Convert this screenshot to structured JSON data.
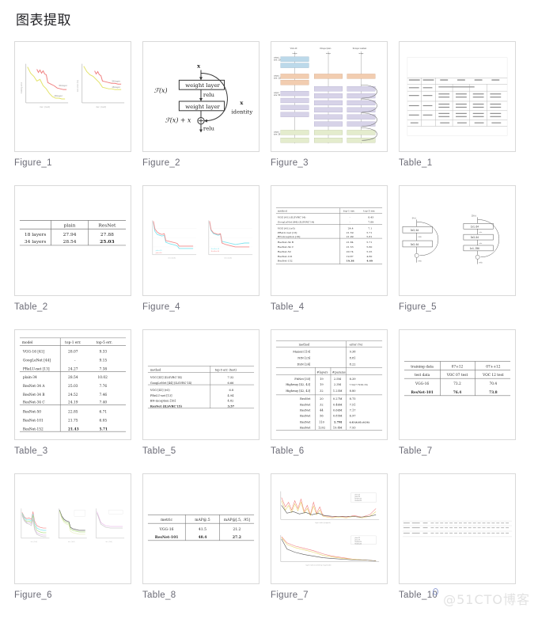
{
  "header": {
    "title": "图表提取"
  },
  "watermark": {
    "text": "@51CTO博客"
  },
  "grid": {
    "columns": 4,
    "items": [
      {
        "id": "figure-1",
        "caption": "Figure_1",
        "kind": "figure",
        "variant": "training-curves-2"
      },
      {
        "id": "figure-2",
        "caption": "Figure_2",
        "kind": "figure",
        "variant": "residual-block"
      },
      {
        "id": "figure-3",
        "caption": "Figure_3",
        "kind": "figure",
        "variant": "network-columns"
      },
      {
        "id": "table-1",
        "caption": "Table_1",
        "kind": "table",
        "variant": "wide-arch-table"
      },
      {
        "id": "table-2",
        "caption": "Table_2",
        "kind": "table",
        "variant": "table2"
      },
      {
        "id": "figure-4",
        "caption": "Figure_4",
        "kind": "figure",
        "variant": "cyan-red-curves-2"
      },
      {
        "id": "table-4",
        "caption": "Table_4",
        "kind": "table",
        "variant": "table4"
      },
      {
        "id": "figure-5",
        "caption": "Figure_5",
        "kind": "figure",
        "variant": "bottleneck-pair"
      },
      {
        "id": "table-3",
        "caption": "Table_3",
        "kind": "table",
        "variant": "table3"
      },
      {
        "id": "table-5",
        "caption": "Table_5",
        "kind": "table",
        "variant": "table5"
      },
      {
        "id": "table-6",
        "caption": "Table_6",
        "kind": "table",
        "variant": "table6"
      },
      {
        "id": "table-7",
        "caption": "Table_7",
        "kind": "table",
        "variant": "table7"
      },
      {
        "id": "figure-6",
        "caption": "Figure_6",
        "kind": "figure",
        "variant": "cifar-curves-3"
      },
      {
        "id": "table-8",
        "caption": "Table_8",
        "kind": "table",
        "variant": "table8"
      },
      {
        "id": "figure-7",
        "caption": "Figure_7",
        "kind": "figure",
        "variant": "response-std-2"
      },
      {
        "id": "table-10",
        "caption": "Table_10",
        "kind": "table",
        "variant": "wide-strip-table"
      }
    ]
  },
  "figures": {
    "figure_1": {
      "panels": [
        {
          "ylabel": "training error (%)",
          "xlabel": "iter. (1e4)",
          "series": [
            {
              "name": "34-layer",
              "color": "#f08080"
            },
            {
              "name": "18-layer",
              "color": "#e3e36a"
            }
          ]
        },
        {
          "ylabel": "test error (%)",
          "xlabel": "iter. (1e4)",
          "series": [
            {
              "name": "34-layer",
              "color": "#f08080"
            },
            {
              "name": "18-layer",
              "color": "#e3e36a"
            }
          ]
        }
      ]
    },
    "figure_2": {
      "nodes": [
        "x",
        "weight layer",
        "relu",
        "weight layer"
      ],
      "labels": {
        "fx": "F(x)",
        "sum": "F(x) + x",
        "identity": "identity",
        "identity_x": "x",
        "out_relu": "relu"
      }
    },
    "figure_3": {
      "column_titles": [
        "VGG-19",
        "34-layer plain",
        "34-layer residual"
      ],
      "output_sizes": [
        "output size: 224",
        "output size: 112",
        "output size: 56",
        "output size: 28"
      ],
      "colors": {
        "image": "#bcd9ea",
        "conv64": "#f2cdb0",
        "conv128": "#d7d3e8",
        "conv256": "#e4eccd"
      }
    },
    "figure_4": {
      "panels": [
        {
          "series": [
            {
              "name": "plain-18",
              "color": "#7fe4ef"
            },
            {
              "name": "plain-34",
              "color": "#f28c8c"
            }
          ]
        },
        {
          "series": [
            {
              "name": "ResNet-18",
              "color": "#7fe4ef"
            },
            {
              "name": "ResNet-34",
              "color": "#f28c8c"
            }
          ]
        }
      ],
      "xlabel": "iter. (1e4)",
      "ylabel": "error (%)"
    },
    "figure_5": {
      "left": {
        "blocks": [
          "3x3, 64",
          "3x3, 64"
        ],
        "relu": "relu"
      },
      "right": {
        "blocks": [
          "1x1, 64",
          "3x3, 64",
          "1x1, 256"
        ],
        "relu": "relu"
      }
    },
    "figure_6": {
      "panels": [
        {
          "legend": [
            "20-layer",
            "32-layer",
            "44-layer",
            "56-layer",
            "110-layer"
          ],
          "xlabel": "iter. (1e4)",
          "ylabel": "error (%)"
        },
        {
          "legend": [
            "ResNet-20",
            "ResNet-32",
            "ResNet-44",
            "ResNet-56",
            "ResNet-110"
          ],
          "xlabel": "iter. (1e4)",
          "ylabel": "error (%)"
        },
        {
          "legend": [
            "ResNet-110",
            "ResNet-1202"
          ],
          "xlabel": "iter. (1e4)",
          "ylabel": "error (%)"
        }
      ]
    },
    "figure_7": {
      "panels": [
        {
          "xlabel": "layer index (original)",
          "ylabel": "std",
          "legend": [
            "plain-20",
            "plain-56",
            "ResNet-20",
            "ResNet-56",
            "ResNet-110"
          ]
        },
        {
          "xlabel": "layer index (sorted by magnitude)",
          "ylabel": "std",
          "legend": [
            "plain-20",
            "plain-56",
            "ResNet-20",
            "ResNet-56",
            "ResNet-110"
          ]
        }
      ]
    }
  },
  "tables": {
    "table_1": {
      "headers": [
        "layer name",
        "output size",
        "18-layer",
        "34-layer",
        "50-layer",
        "101-layer",
        "152-layer"
      ],
      "row_count": 6
    },
    "table_2": {
      "headers": [
        "",
        "plain",
        "ResNet"
      ],
      "rows": [
        {
          "cells": [
            "18 layers",
            "27.94",
            "27.88"
          ],
          "bold": []
        },
        {
          "cells": [
            "34 layers",
            "28.54",
            "25.03"
          ],
          "bold": [
            2
          ]
        }
      ]
    },
    "table_3": {
      "headers": [
        "model",
        "top-1 err.",
        "top-5 err."
      ],
      "groups": [
        [
          {
            "cells": [
              "VGG-16 [41]",
              "28.07",
              "9.33"
            ]
          },
          {
            "cells": [
              "GoogLeNet [44]",
              "-",
              "9.15"
            ]
          },
          {
            "cells": [
              "PReLU-net [13]",
              "24.27",
              "7.38"
            ]
          }
        ],
        [
          {
            "cells": [
              "plain-34",
              "28.54",
              "10.02"
            ]
          },
          {
            "cells": [
              "ResNet-34 A",
              "25.03",
              "7.76"
            ]
          },
          {
            "cells": [
              "ResNet-34 B",
              "24.52",
              "7.46"
            ]
          },
          {
            "cells": [
              "ResNet-34 C",
              "24.19",
              "7.40"
            ]
          }
        ],
        [
          {
            "cells": [
              "ResNet-50",
              "22.85",
              "6.71"
            ]
          },
          {
            "cells": [
              "ResNet-101",
              "21.75",
              "6.05"
            ]
          },
          {
            "cells": [
              "ResNet-152",
              "21.43",
              "5.71"
            ],
            "bold": [
              1,
              2
            ]
          }
        ]
      ]
    },
    "table_4": {
      "headers": [
        "method",
        "top-1 err.",
        "top-5 err."
      ],
      "groups": [
        [
          {
            "cells": [
              "VGG [41] (ILSVRC'14)",
              "-",
              "8.43"
            ]
          },
          {
            "cells": [
              "GoogLeNet [44] (ILSVRC'14)",
              "-",
              "7.89"
            ]
          }
        ],
        [
          {
            "cells": [
              "VGG [41] (v5)",
              "24.4",
              "7.1"
            ]
          },
          {
            "cells": [
              "PReLU-net [13]",
              "21.59",
              "5.71"
            ]
          },
          {
            "cells": [
              "BN-inception [16]",
              "21.99",
              "5.81"
            ]
          }
        ],
        [
          {
            "cells": [
              "ResNet-34 B",
              "21.84",
              "5.71"
            ]
          },
          {
            "cells": [
              "ResNet-34 C",
              "21.53",
              "5.60"
            ]
          },
          {
            "cells": [
              "ResNet-50",
              "20.74",
              "5.25"
            ]
          },
          {
            "cells": [
              "ResNet-101",
              "19.87",
              "4.60"
            ]
          },
          {
            "cells": [
              "ResNet-152",
              "19.38",
              "4.49"
            ],
            "bold": [
              1,
              2
            ]
          }
        ]
      ]
    },
    "table_5": {
      "headers": [
        "method",
        "top-5 err. (test)"
      ],
      "groups": [
        [
          {
            "cells": [
              "VGG [41] (ILSVRC'14)",
              "7.32"
            ]
          },
          {
            "cells": [
              "GoogLeNet [44] (ILSVRC'14)",
              "6.66"
            ]
          }
        ],
        [
          {
            "cells": [
              "VGG [41] (v5)",
              "6.8"
            ]
          },
          {
            "cells": [
              "PReLU-net [13]",
              "4.94"
            ]
          },
          {
            "cells": [
              "BN-inception [16]",
              "4.82"
            ]
          },
          {
            "cells": [
              "ResNet (ILSVRC'15)",
              "3.57"
            ],
            "bold": [
              0,
              1
            ]
          }
        ]
      ]
    },
    "table_6": {
      "headers": [
        "method",
        "error (%)"
      ],
      "sub_headers": [
        "",
        "# layers",
        "# params",
        ""
      ],
      "top_rows": [
        {
          "cells": [
            "Maxout [10]",
            "9.38"
          ]
        },
        {
          "cells": [
            "NIN [25]",
            "8.81"
          ]
        },
        {
          "cells": [
            "DSN [24]",
            "8.22"
          ]
        }
      ],
      "rows": [
        {
          "cells": [
            "FitNet [35]",
            "19",
            "2.5M",
            "8.39"
          ]
        },
        {
          "cells": [
            "Highway [42, 43]",
            "19",
            "2.3M",
            "7.54 (7.72±0.16)"
          ]
        },
        {
          "cells": [
            "Highway [42, 43]",
            "32",
            "1.25M",
            "8.80"
          ]
        },
        {
          "cells": [
            "ResNet",
            "20",
            "0.27M",
            "8.75"
          ]
        },
        {
          "cells": [
            "ResNet",
            "32",
            "0.46M",
            "7.51"
          ]
        },
        {
          "cells": [
            "ResNet",
            "44",
            "0.66M",
            "7.17"
          ]
        },
        {
          "cells": [
            "ResNet",
            "56",
            "0.85M",
            "6.97"
          ]
        },
        {
          "cells": [
            "ResNet",
            "110",
            "1.7M",
            "6.43 (6.61±0.16)"
          ],
          "bold": [
            3
          ]
        },
        {
          "cells": [
            "ResNet",
            "1202",
            "19.4M",
            "7.93"
          ]
        }
      ]
    },
    "table_7": {
      "rows": [
        {
          "cells": [
            "training data",
            "07+12",
            "07++12"
          ]
        },
        {
          "cells": [
            "test data",
            "VOC 07 test",
            "VOC 12 test"
          ]
        },
        {
          "cells": [
            "VGG-16",
            "73.2",
            "70.4"
          ]
        },
        {
          "cells": [
            "ResNet-101",
            "76.4",
            "73.8"
          ],
          "bold": [
            0,
            1,
            2
          ]
        }
      ]
    },
    "table_8": {
      "headers": [
        "metric",
        "mAP@.5",
        "mAP@[.5, .95]"
      ],
      "rows": [
        {
          "cells": [
            "VGG-16",
            "41.5",
            "21.2"
          ]
        },
        {
          "cells": [
            "ResNet-101",
            "48.4",
            "27.2"
          ],
          "bold": [
            0,
            1,
            2
          ]
        }
      ]
    },
    "table_10": {
      "row_count": 2,
      "col_count": 26
    }
  }
}
